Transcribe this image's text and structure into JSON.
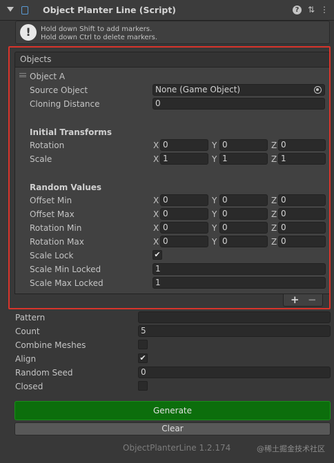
{
  "header": {
    "title": "Object Planter Line (Script)",
    "help_icon": "question-icon",
    "preset_icon": "sliders-icon",
    "menu_icon": "kebab-menu-icon"
  },
  "helpbox": {
    "line1": "Hold down Shift to add markers.",
    "line2": "Hold down Ctrl to delete markers."
  },
  "objects_list": {
    "header": "Objects",
    "element_label": "Object A",
    "source_object_label": "Source Object",
    "source_object_value": "None (Game Object)",
    "cloning_distance_label": "Cloning Distance",
    "cloning_distance_value": "0",
    "initial_transforms_heading": "Initial Transforms",
    "rotation_label": "Rotation",
    "rotation": {
      "x": "0",
      "y": "0",
      "z": "0"
    },
    "scale_label": "Scale",
    "scale": {
      "x": "1",
      "y": "1",
      "z": "1"
    },
    "random_values_heading": "Random Values",
    "offset_min_label": "Offset Min",
    "offset_min": {
      "x": "0",
      "y": "0",
      "z": "0"
    },
    "offset_max_label": "Offset Max",
    "offset_max": {
      "x": "0",
      "y": "0",
      "z": "0"
    },
    "rotation_min_label": "Rotation Min",
    "rotation_min": {
      "x": "0",
      "y": "0",
      "z": "0"
    },
    "rotation_max_label": "Rotation Max",
    "rotation_max": {
      "x": "0",
      "y": "0",
      "z": "0"
    },
    "scale_lock_label": "Scale Lock",
    "scale_lock_checked": true,
    "scale_min_locked_label": "Scale Min Locked",
    "scale_min_locked_value": "1",
    "scale_max_locked_label": "Scale Max Locked",
    "scale_max_locked_value": "1",
    "axis_labels": {
      "x": "X",
      "y": "Y",
      "z": "Z"
    },
    "add_label": "+",
    "remove_label": "−"
  },
  "settings": {
    "pattern_label": "Pattern",
    "pattern_value": "",
    "count_label": "Count",
    "count_value": "5",
    "combine_meshes_label": "Combine Meshes",
    "combine_meshes_checked": false,
    "align_label": "Align",
    "align_checked": true,
    "random_seed_label": "Random Seed",
    "random_seed_value": "0",
    "closed_label": "Closed",
    "closed_checked": false
  },
  "buttons": {
    "generate": "Generate",
    "clear": "Clear"
  },
  "footer": {
    "version": "ObjectPlanterLine 1.2.174",
    "watermark": "@稀土掘金技术社区"
  },
  "colors": {
    "background": "#383838",
    "highlight_outline": "#d9342b",
    "generate_button": "#0c6e0c",
    "field_background": "#2a2a2a"
  }
}
